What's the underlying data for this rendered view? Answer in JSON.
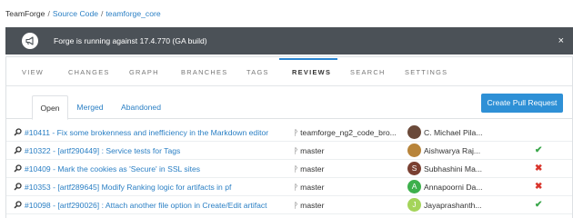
{
  "breadcrumb": {
    "root": "TeamForge",
    "sep": "/",
    "section": "Source Code",
    "repo": "teamforge_core"
  },
  "banner": {
    "message": "Forge is running against 17.4.770 (GA build)",
    "close": "×",
    "icon": "megaphone-icon"
  },
  "tabs": [
    "VIEW",
    "CHANGES",
    "GRAPH",
    "BRANCHES",
    "TAGS",
    "REVIEWS",
    "SEARCH",
    "SETTINGS"
  ],
  "active_tab": "REVIEWS",
  "subtabs": [
    "Open",
    "Merged",
    "Abandoned"
  ],
  "active_subtab": "Open",
  "create_button": "Create Pull Request",
  "colors": {
    "accent": "#2e90d6",
    "link": "#2a7fc4",
    "ok": "#3aa64a",
    "fail": "#d9342b",
    "banner": "#4b5157"
  },
  "reviews": [
    {
      "title": "#10411 - Fix some brokenness and inefficiency in the Markdown editor",
      "branch": "teamforge_ng2_code_bro...",
      "author": "C. Michael Pila...",
      "avatar_letter": "",
      "avatar_color": "#6b4a3a",
      "status": "",
      "status_icon": ""
    },
    {
      "title": "#10322 - [artf290449] : Service tests for Tags",
      "branch": "master",
      "author": "Aishwarya Raj...",
      "avatar_letter": "",
      "avatar_color": "#b8843a",
      "status": "✔",
      "status_icon": "check-icon"
    },
    {
      "title": "#10409 - Mark the cookies as 'Secure' in SSL sites",
      "branch": "master",
      "author": "Subhashini Ma...",
      "avatar_letter": "S",
      "avatar_color": "#7a4032",
      "status": "✖",
      "status_icon": "cross-icon"
    },
    {
      "title": "#10353 - [artf289645] Modify Ranking logic for artifacts in pf",
      "branch": "master",
      "author": "Annapoorni Da...",
      "avatar_letter": "A",
      "avatar_color": "#3db04c",
      "status": "✖",
      "status_icon": "cross-icon"
    },
    {
      "title": "#10098 - [artf290026] : Attach another file option in Create/Edit artifact",
      "branch": "master",
      "author": "Jayaprashanth...",
      "avatar_letter": "J",
      "avatar_color": "#a4d45a",
      "status": "✔",
      "status_icon": "check-icon"
    }
  ]
}
